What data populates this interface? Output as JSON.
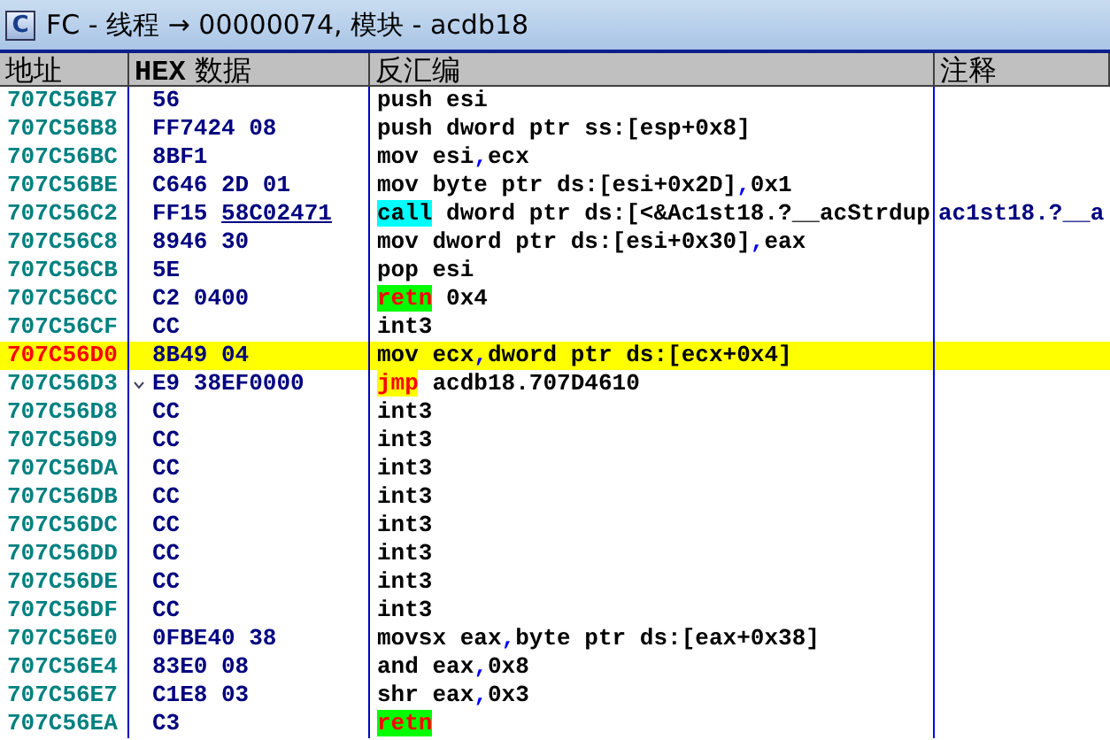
{
  "window": {
    "icon_letter": "C",
    "title": "FC - 线程 → 00000074, 模块 - acdb18"
  },
  "table": {
    "columns": [
      "地址",
      "HEX 数据",
      "反汇编",
      "注释"
    ],
    "rows": [
      {
        "address": "707C56B7",
        "hex": "56",
        "mnemonic": "push",
        "operands": "esi",
        "kind": "plain",
        "selected": false
      },
      {
        "address": "707C56B8",
        "hex": "FF7424 08",
        "mnemonic": "push",
        "operands": "dword ptr ss:[esp+0x8]",
        "kind": "plain",
        "selected": false
      },
      {
        "address": "707C56BC",
        "hex": "8BF1",
        "mnemonic": "mov",
        "operands": "esi,ecx",
        "kind": "plain",
        "selected": false
      },
      {
        "address": "707C56BE",
        "hex": "C646 2D 01",
        "mnemonic": "mov",
        "operands": "byte ptr ds:[esi+0x2D],0x1",
        "kind": "plain",
        "selected": false
      },
      {
        "address": "707C56C2",
        "hex": "FF15",
        "hex_link": "58C02471",
        "mnemonic": "call",
        "operands": "dword ptr ds:[<&Ac1st18.?__acStrdup",
        "kind": "call",
        "selected": false,
        "comment": "ac1st18.?__a"
      },
      {
        "address": "707C56C8",
        "hex": "8946 30",
        "mnemonic": "mov",
        "operands": "dword ptr ds:[esi+0x30],eax",
        "kind": "plain",
        "selected": false
      },
      {
        "address": "707C56CB",
        "hex": "5E",
        "mnemonic": "pop",
        "operands": "esi",
        "kind": "plain",
        "selected": false
      },
      {
        "address": "707C56CC",
        "hex": "C2 0400",
        "mnemonic": "retn",
        "operands": "0x4",
        "kind": "ret",
        "selected": false
      },
      {
        "address": "707C56CF",
        "hex": "CC",
        "mnemonic": "int3",
        "kind": "plain",
        "selected": false
      },
      {
        "address": "707C56D0",
        "hex": "8B49 04",
        "mnemonic": "mov",
        "operands": "ecx,dword ptr ds:[ecx+0x4]",
        "kind": "plain",
        "selected": true
      },
      {
        "address": "707C56D3",
        "hex": "E9 38EF0000",
        "mnemonic": "jmp",
        "operands": "acdb18.707D4610",
        "kind": "jmp",
        "selected": false,
        "jump_marker": true
      },
      {
        "address": "707C56D8",
        "hex": "CC",
        "mnemonic": "int3",
        "kind": "plain",
        "selected": false
      },
      {
        "address": "707C56D9",
        "hex": "CC",
        "mnemonic": "int3",
        "kind": "plain",
        "selected": false
      },
      {
        "address": "707C56DA",
        "hex": "CC",
        "mnemonic": "int3",
        "kind": "plain",
        "selected": false
      },
      {
        "address": "707C56DB",
        "hex": "CC",
        "mnemonic": "int3",
        "kind": "plain",
        "selected": false
      },
      {
        "address": "707C56DC",
        "hex": "CC",
        "mnemonic": "int3",
        "kind": "plain",
        "selected": false
      },
      {
        "address": "707C56DD",
        "hex": "CC",
        "mnemonic": "int3",
        "kind": "plain",
        "selected": false
      },
      {
        "address": "707C56DE",
        "hex": "CC",
        "mnemonic": "int3",
        "kind": "plain",
        "selected": false
      },
      {
        "address": "707C56DF",
        "hex": "CC",
        "mnemonic": "int3",
        "kind": "plain",
        "selected": false
      },
      {
        "address": "707C56E0",
        "hex": "0FBE40 38",
        "mnemonic": "movsx",
        "operands": "eax,byte ptr ds:[eax+0x38]",
        "kind": "plain",
        "selected": false
      },
      {
        "address": "707C56E4",
        "hex": "83E0 08",
        "mnemonic": "and",
        "operands": "eax,0x8",
        "kind": "plain",
        "selected": false
      },
      {
        "address": "707C56E7",
        "hex": "C1E8 03",
        "mnemonic": "shr",
        "operands": "eax,0x3",
        "kind": "plain",
        "selected": false
      },
      {
        "address": "707C56EA",
        "hex": "C3",
        "mnemonic": "retn",
        "kind": "ret",
        "selected": false
      }
    ]
  }
}
